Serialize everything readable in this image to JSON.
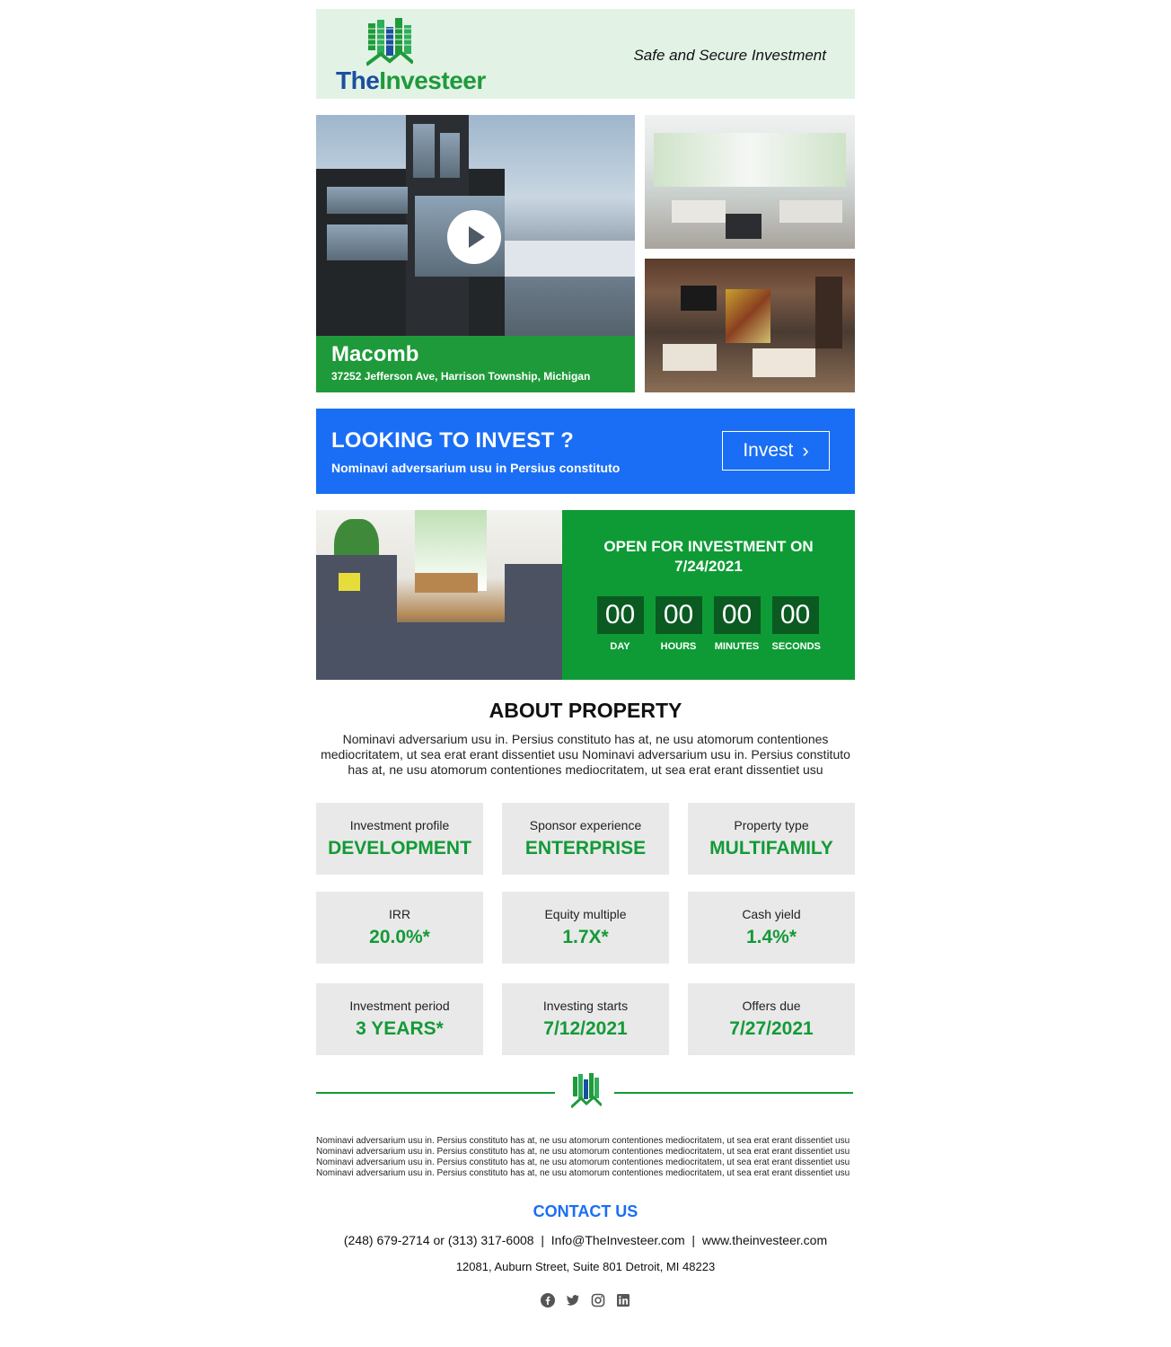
{
  "brand": {
    "name_part1": "The",
    "name_part2": "Investeer",
    "tagline": "Safe and Secure Investment",
    "colors": {
      "green": "#1f9a3a",
      "blue": "#1b4fa0",
      "accent_blue": "#1a6ef5",
      "header_bg": "#e2f3e6"
    }
  },
  "property": {
    "city": "Macomb",
    "address": "37252 Jefferson Ave, Harrison Township, Michigan",
    "icons": {
      "play": "play-icon"
    }
  },
  "banner": {
    "title": "LOOKING TO INVEST ?",
    "subtitle": "Nominavi adversarium usu in Persius constituto",
    "button_label": "Invest",
    "button_icon": "chevron-right-icon"
  },
  "countdown": {
    "title_line1": "OPEN FOR INVESTMENT ON",
    "title_line2": "7/24/2021",
    "units": [
      {
        "value": "00",
        "label": "DAY"
      },
      {
        "value": "00",
        "label": "HOURS"
      },
      {
        "value": "00",
        "label": "MINUTES"
      },
      {
        "value": "00",
        "label": "SECONDS"
      }
    ]
  },
  "about": {
    "title": "ABOUT PROPERTY",
    "text": "Nominavi adversarium usu in. Persius constituto has at, ne usu atomorum contentiones mediocritatem, ut sea erat erant dissentiet usu Nominavi adversarium usu in. Persius constituto has at, ne usu atomorum contentiones mediocritatem, ut sea erat erant dissentiet usu"
  },
  "stats": [
    {
      "label": "Investment profile",
      "value": "DEVELOPMENT"
    },
    {
      "label": "Sponsor experience",
      "value": "ENTERPRISE"
    },
    {
      "label": "Property type",
      "value": "MULTIFAMILY"
    },
    {
      "label": "IRR",
      "value": "20.0%*"
    },
    {
      "label": "Equity multiple",
      "value": "1.7X*"
    },
    {
      "label": "Cash yield",
      "value": "1.4%*"
    },
    {
      "label": "Investment period",
      "value": "3 YEARS*"
    },
    {
      "label": "Investing starts",
      "value": "7/12/2021"
    },
    {
      "label": "Offers due",
      "value": "7/27/2021"
    }
  ],
  "footer": {
    "fine_print": "Nominavi adversarium usu in. Persius constituto has at, ne usu atomorum contentiones mediocritatem, ut sea erat erant dissentiet usu Nominavi adversarium usu in. Persius constituto has at, ne usu atomorum contentiones mediocritatem, ut sea erat erant dissentiet usu Nominavi adversarium usu in. Persius constituto has at, ne usu atomorum contentiones mediocritatem, ut sea erat erant dissentiet usu Nominavi adversarium usu in. Persius constituto has at, ne usu atomorum contentiones mediocritatem, ut sea erat erant dissentiet usu",
    "contact_title": "CONTACT US",
    "phones": "(248) 679-2714 or (313) 317-6008",
    "email": "Info@TheInvesteer.com",
    "website": "www.theinvesteer.com",
    "separator": "|",
    "address": "12081, Auburn Street, Suite 801 Detroit, MI 48223",
    "social_icons": [
      "facebook-icon",
      "twitter-icon",
      "instagram-icon",
      "linkedin-icon"
    ]
  }
}
